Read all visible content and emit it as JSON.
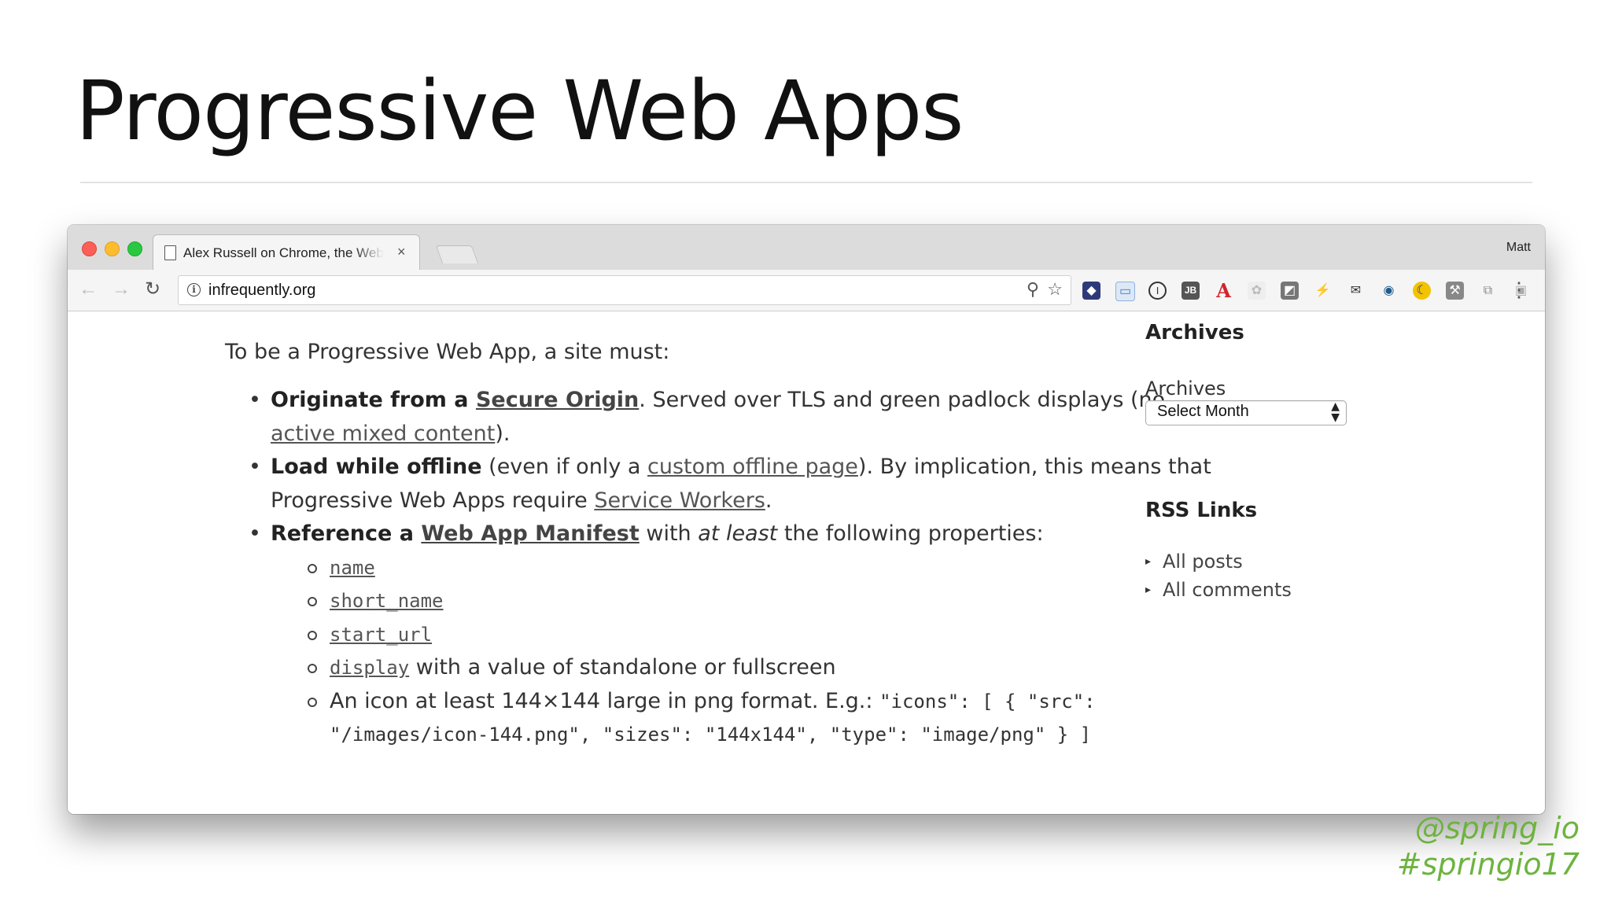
{
  "slide": {
    "title": "Progressive Web Apps",
    "handle": "@spring_io",
    "hashtag": "#springio17",
    "accent_color": "#6db33f"
  },
  "browser": {
    "tab_title": "Alex Russell on Chrome, the Web",
    "tab_close": "×",
    "profile_name": "Matt",
    "url": "infrequently.org",
    "icons": {
      "back": "back-arrow-icon",
      "forward": "forward-arrow-icon",
      "reload": "reload-icon",
      "info": "info-icon",
      "zoom": "zoom-icon",
      "star": "bookmark-star-icon",
      "menu": "more-menu-icon"
    },
    "extensions": [
      "shield-extension-icon",
      "window-extension-icon",
      "onepassword-icon",
      "jetbrains-icon",
      "font-a-icon",
      "puzzle-extension-icon",
      "square-extension-icon",
      "bolt-extension-icon",
      "mail-extension-icon",
      "spy-extension-icon",
      "moon-extension-icon",
      "hammer-extension-icon",
      "translate-extension-icon",
      "box-extension-icon",
      "chrome-extension-icon"
    ]
  },
  "content": {
    "intro": "To be a Progressive Web App, a site must:",
    "item1": {
      "bold": "Originate from a ",
      "link": "Secure Origin",
      "text": ". Served over TLS and green padlock displays (no ",
      "link2": "active mixed content",
      "end": ")."
    },
    "item2": {
      "bold": "Load while offline",
      "text": " (even if only a ",
      "link": "custom offline page",
      "text2": "). By implication, this means that Progressive Web Apps require ",
      "link2": "Service Workers",
      "end": "."
    },
    "item3": {
      "bold": "Reference a ",
      "link": "Web App Manifest",
      "text": " with ",
      "em": "at least",
      "end": " the following properties:"
    },
    "props": [
      "name",
      "short_name",
      "start_url"
    ],
    "display": {
      "link": "display",
      "text": " with a value of standalone or fullscreen"
    },
    "icon_req": {
      "text": "An icon at least 144×144 large in png format. E.g.: ",
      "code": "\"icons\": [ { \"src\": \"/images/icon-144.png\", \"sizes\": \"144x144\", \"type\": \"image/png\" } ]"
    }
  },
  "sidebar": {
    "archives_heading": "Archives",
    "archives_label": "Archives",
    "select_value": "Select Month",
    "rss_heading": "RSS Links",
    "rss_links": [
      "All posts",
      "All comments"
    ]
  }
}
